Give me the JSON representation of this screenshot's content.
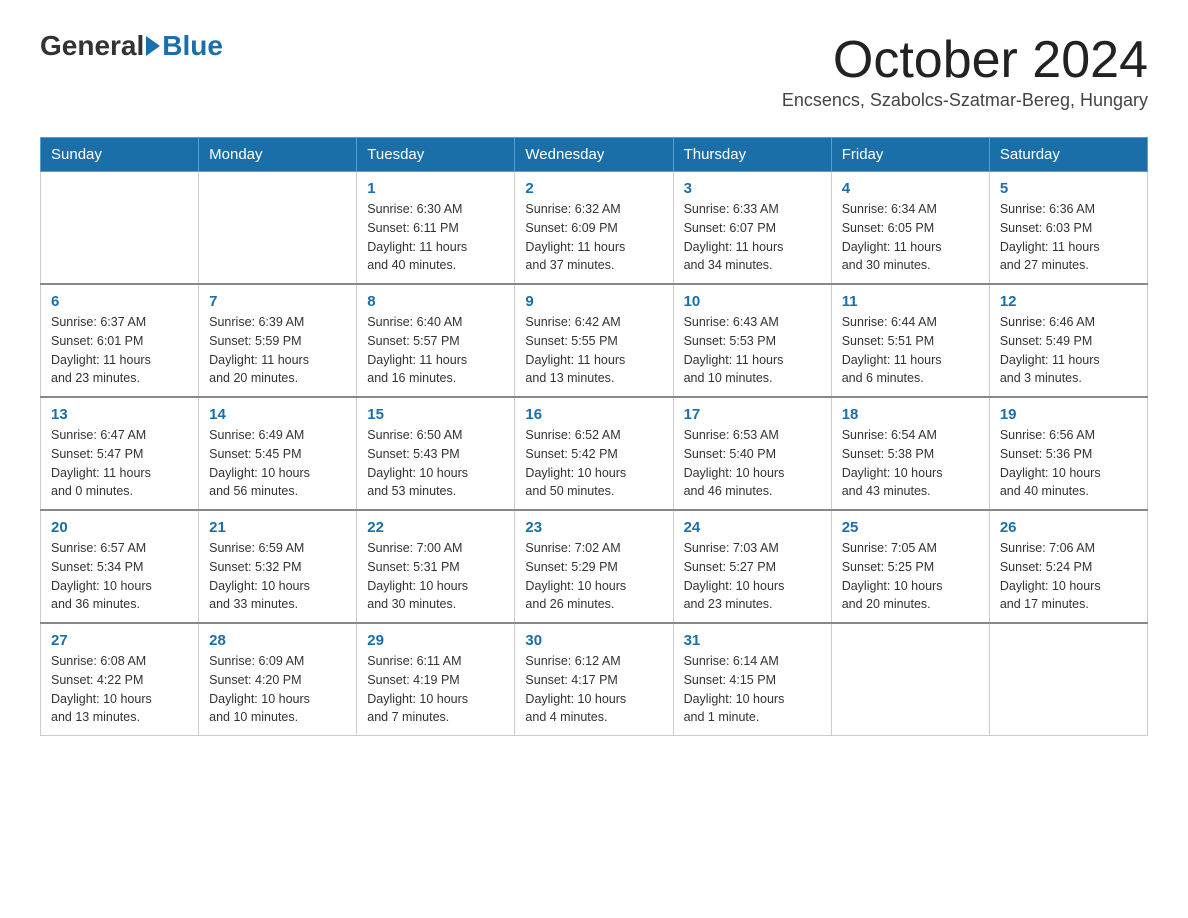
{
  "header": {
    "logo_general": "General",
    "logo_blue": "Blue",
    "month_title": "October 2024",
    "subtitle": "Encsencs, Szabolcs-Szatmar-Bereg, Hungary"
  },
  "weekdays": [
    "Sunday",
    "Monday",
    "Tuesday",
    "Wednesday",
    "Thursday",
    "Friday",
    "Saturday"
  ],
  "weeks": [
    [
      {
        "day": "",
        "info": ""
      },
      {
        "day": "",
        "info": ""
      },
      {
        "day": "1",
        "info": "Sunrise: 6:30 AM\nSunset: 6:11 PM\nDaylight: 11 hours\nand 40 minutes."
      },
      {
        "day": "2",
        "info": "Sunrise: 6:32 AM\nSunset: 6:09 PM\nDaylight: 11 hours\nand 37 minutes."
      },
      {
        "day": "3",
        "info": "Sunrise: 6:33 AM\nSunset: 6:07 PM\nDaylight: 11 hours\nand 34 minutes."
      },
      {
        "day": "4",
        "info": "Sunrise: 6:34 AM\nSunset: 6:05 PM\nDaylight: 11 hours\nand 30 minutes."
      },
      {
        "day": "5",
        "info": "Sunrise: 6:36 AM\nSunset: 6:03 PM\nDaylight: 11 hours\nand 27 minutes."
      }
    ],
    [
      {
        "day": "6",
        "info": "Sunrise: 6:37 AM\nSunset: 6:01 PM\nDaylight: 11 hours\nand 23 minutes."
      },
      {
        "day": "7",
        "info": "Sunrise: 6:39 AM\nSunset: 5:59 PM\nDaylight: 11 hours\nand 20 minutes."
      },
      {
        "day": "8",
        "info": "Sunrise: 6:40 AM\nSunset: 5:57 PM\nDaylight: 11 hours\nand 16 minutes."
      },
      {
        "day": "9",
        "info": "Sunrise: 6:42 AM\nSunset: 5:55 PM\nDaylight: 11 hours\nand 13 minutes."
      },
      {
        "day": "10",
        "info": "Sunrise: 6:43 AM\nSunset: 5:53 PM\nDaylight: 11 hours\nand 10 minutes."
      },
      {
        "day": "11",
        "info": "Sunrise: 6:44 AM\nSunset: 5:51 PM\nDaylight: 11 hours\nand 6 minutes."
      },
      {
        "day": "12",
        "info": "Sunrise: 6:46 AM\nSunset: 5:49 PM\nDaylight: 11 hours\nand 3 minutes."
      }
    ],
    [
      {
        "day": "13",
        "info": "Sunrise: 6:47 AM\nSunset: 5:47 PM\nDaylight: 11 hours\nand 0 minutes."
      },
      {
        "day": "14",
        "info": "Sunrise: 6:49 AM\nSunset: 5:45 PM\nDaylight: 10 hours\nand 56 minutes."
      },
      {
        "day": "15",
        "info": "Sunrise: 6:50 AM\nSunset: 5:43 PM\nDaylight: 10 hours\nand 53 minutes."
      },
      {
        "day": "16",
        "info": "Sunrise: 6:52 AM\nSunset: 5:42 PM\nDaylight: 10 hours\nand 50 minutes."
      },
      {
        "day": "17",
        "info": "Sunrise: 6:53 AM\nSunset: 5:40 PM\nDaylight: 10 hours\nand 46 minutes."
      },
      {
        "day": "18",
        "info": "Sunrise: 6:54 AM\nSunset: 5:38 PM\nDaylight: 10 hours\nand 43 minutes."
      },
      {
        "day": "19",
        "info": "Sunrise: 6:56 AM\nSunset: 5:36 PM\nDaylight: 10 hours\nand 40 minutes."
      }
    ],
    [
      {
        "day": "20",
        "info": "Sunrise: 6:57 AM\nSunset: 5:34 PM\nDaylight: 10 hours\nand 36 minutes."
      },
      {
        "day": "21",
        "info": "Sunrise: 6:59 AM\nSunset: 5:32 PM\nDaylight: 10 hours\nand 33 minutes."
      },
      {
        "day": "22",
        "info": "Sunrise: 7:00 AM\nSunset: 5:31 PM\nDaylight: 10 hours\nand 30 minutes."
      },
      {
        "day": "23",
        "info": "Sunrise: 7:02 AM\nSunset: 5:29 PM\nDaylight: 10 hours\nand 26 minutes."
      },
      {
        "day": "24",
        "info": "Sunrise: 7:03 AM\nSunset: 5:27 PM\nDaylight: 10 hours\nand 23 minutes."
      },
      {
        "day": "25",
        "info": "Sunrise: 7:05 AM\nSunset: 5:25 PM\nDaylight: 10 hours\nand 20 minutes."
      },
      {
        "day": "26",
        "info": "Sunrise: 7:06 AM\nSunset: 5:24 PM\nDaylight: 10 hours\nand 17 minutes."
      }
    ],
    [
      {
        "day": "27",
        "info": "Sunrise: 6:08 AM\nSunset: 4:22 PM\nDaylight: 10 hours\nand 13 minutes."
      },
      {
        "day": "28",
        "info": "Sunrise: 6:09 AM\nSunset: 4:20 PM\nDaylight: 10 hours\nand 10 minutes."
      },
      {
        "day": "29",
        "info": "Sunrise: 6:11 AM\nSunset: 4:19 PM\nDaylight: 10 hours\nand 7 minutes."
      },
      {
        "day": "30",
        "info": "Sunrise: 6:12 AM\nSunset: 4:17 PM\nDaylight: 10 hours\nand 4 minutes."
      },
      {
        "day": "31",
        "info": "Sunrise: 6:14 AM\nSunset: 4:15 PM\nDaylight: 10 hours\nand 1 minute."
      },
      {
        "day": "",
        "info": ""
      },
      {
        "day": "",
        "info": ""
      }
    ]
  ]
}
